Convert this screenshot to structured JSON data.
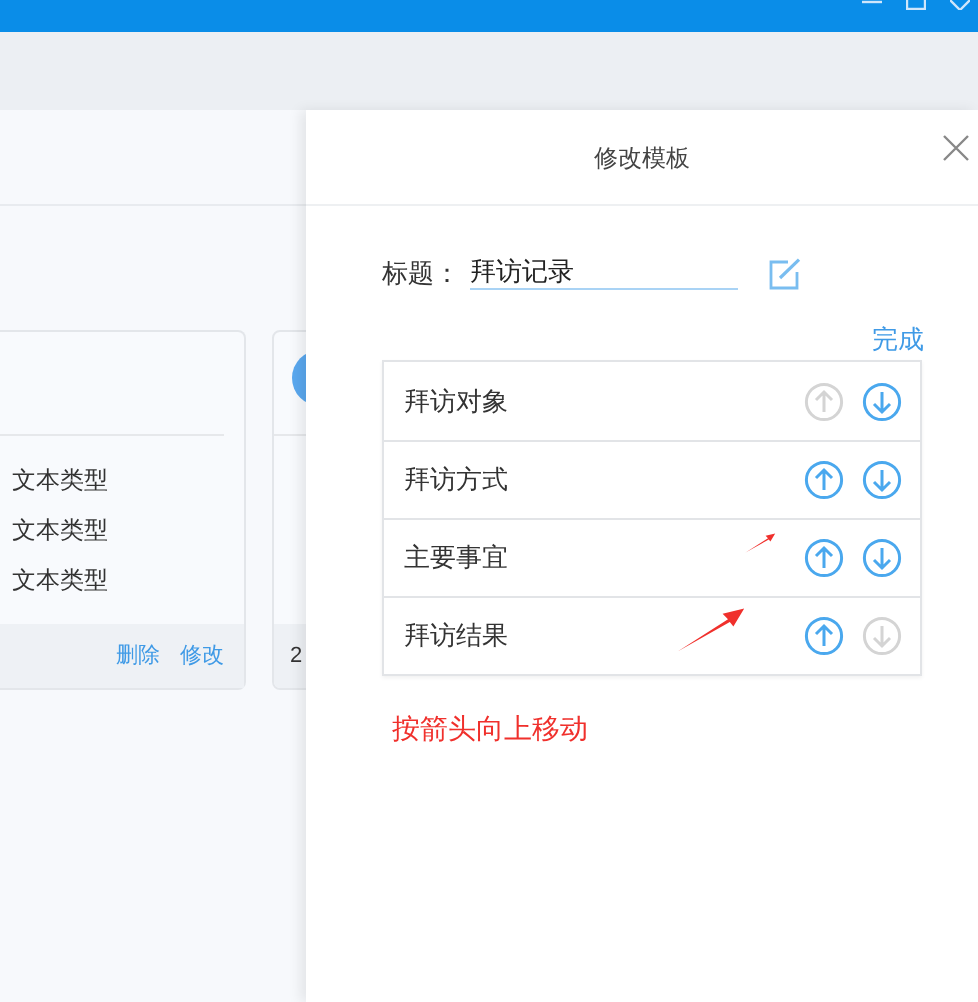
{
  "cards": [
    {
      "lines": [
        "文本类型",
        "文本类型",
        "文本类型"
      ],
      "actions": [
        "删除",
        "修改"
      ]
    },
    {
      "footer": "2"
    }
  ],
  "panel": {
    "title": "修改模板",
    "title_label": "标题：",
    "title_value": "拜访记录",
    "done": "完成",
    "rows": [
      {
        "label": "拜访对象",
        "up_disabled": true,
        "down_disabled": false
      },
      {
        "label": "拜访方式",
        "up_disabled": false,
        "down_disabled": false
      },
      {
        "label": "主要事宜",
        "up_disabled": false,
        "down_disabled": false
      },
      {
        "label": "拜访结果",
        "up_disabled": false,
        "down_disabled": true
      }
    ],
    "hint": "按箭头向上移动"
  }
}
